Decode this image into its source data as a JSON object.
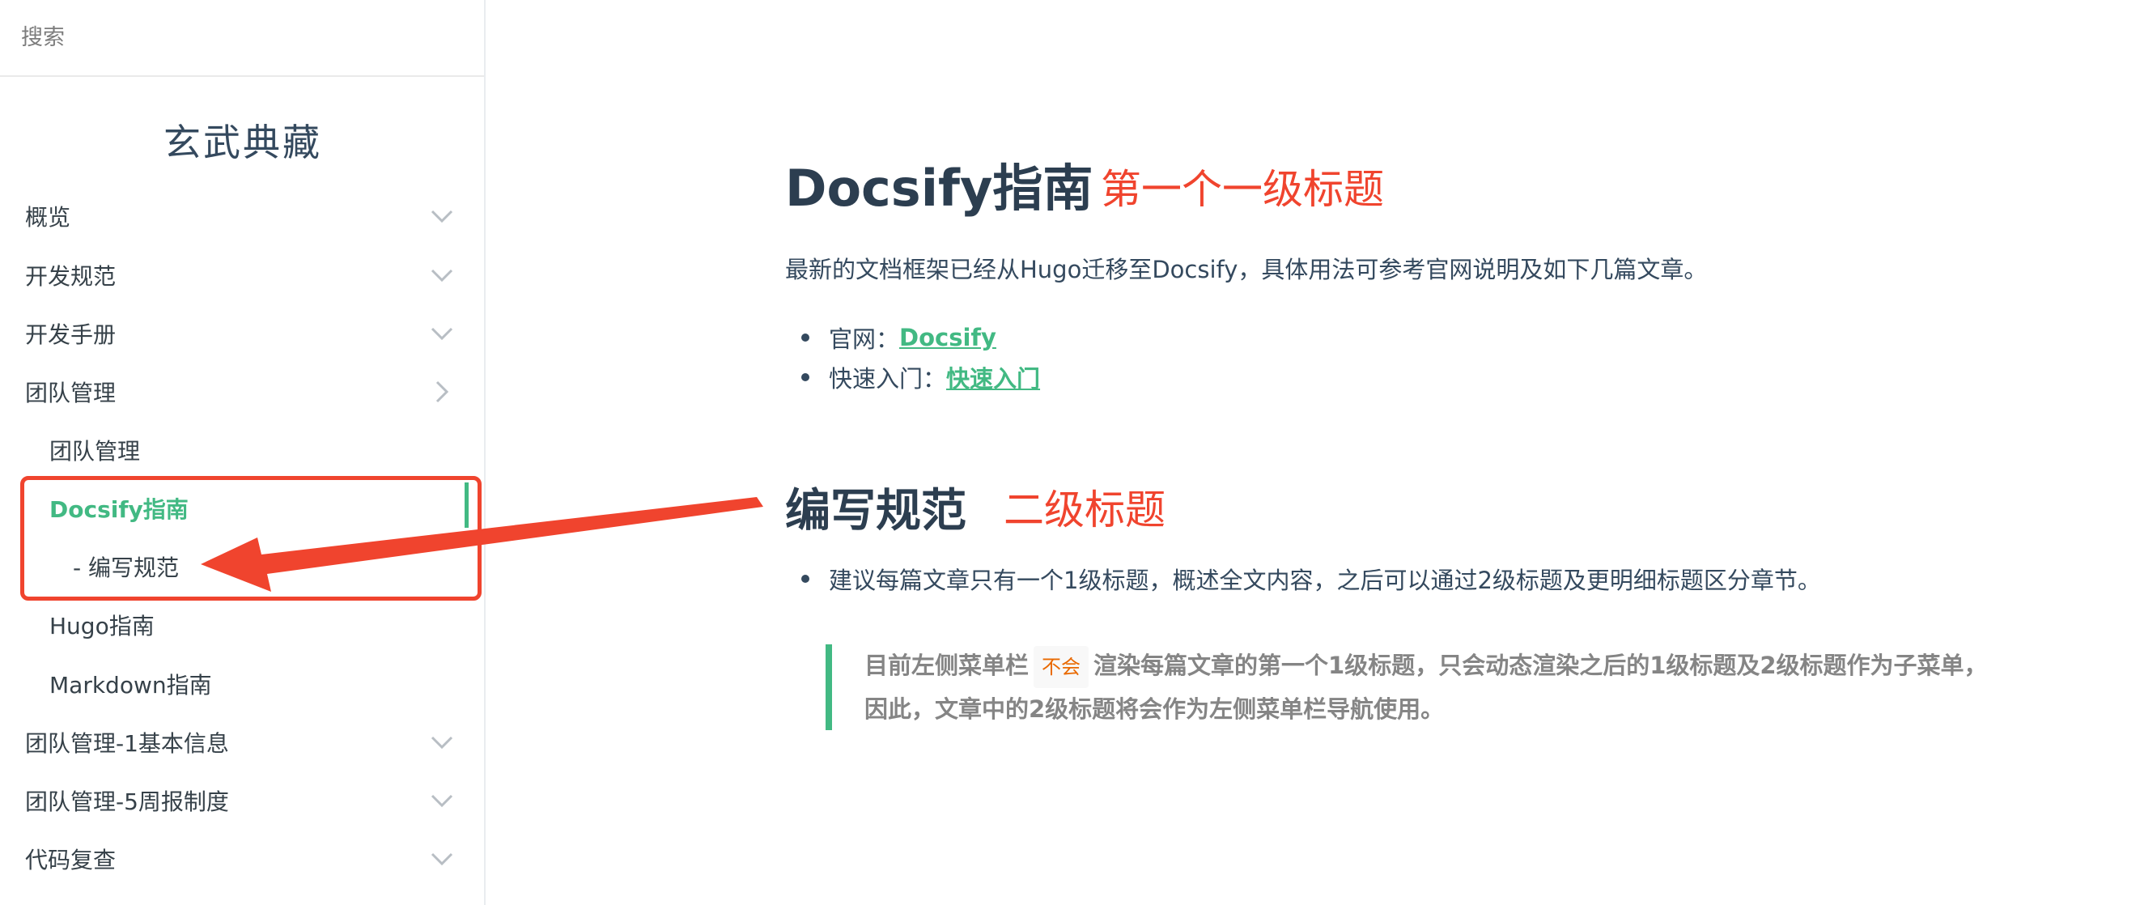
{
  "sidebar": {
    "search_placeholder": "搜索",
    "app_name": "玄武典藏",
    "items": [
      {
        "label": "概览",
        "chevron": "down"
      },
      {
        "label": "开发规范",
        "chevron": "down"
      },
      {
        "label": "开发手册",
        "chevron": "down"
      },
      {
        "label": "团队管理",
        "chevron": "right"
      },
      {
        "label": "团队管理"
      },
      {
        "label": "Docsify指南",
        "active": true
      },
      {
        "label": "- 编写规范"
      },
      {
        "label": "Hugo指南"
      },
      {
        "label": "Markdown指南"
      },
      {
        "label": "团队管理-1基本信息",
        "chevron": "down"
      },
      {
        "label": "团队管理-5周报制度",
        "chevron": "down"
      },
      {
        "label": "代码复查",
        "chevron": "down"
      }
    ]
  },
  "main": {
    "h1": "Docsify指南",
    "h1_annotation": "第一个一级标题",
    "intro": "最新的文档框架已经从Hugo迁移至Docsify，具体用法可参考官网说明及如下几篇文章。",
    "links": [
      {
        "prefix": "官网：",
        "text": "Docsify"
      },
      {
        "prefix": "快速入门：",
        "text": "快速入门"
      }
    ],
    "h2": "编写规范",
    "h2_annotation": "二级标题",
    "bullet2": "建议每篇文章只有一个1级标题，概述全文内容，之后可以通过2级标题及更明细标题区分章节。",
    "quote": {
      "line1_a": "目前左侧菜单栏",
      "code": "不会",
      "line1_b": "渲染每篇文章的第一个1级标题，只会动态渲染之后的1级标题及2级标题作为子菜单，",
      "line2": "因此，文章中的2级标题将会作为左侧菜单栏导航使用。"
    }
  },
  "colors": {
    "accent": "#42b983",
    "annotation": "#f0442e",
    "heading": "#2c3e50",
    "text": "#34495e",
    "code": "#e96900"
  }
}
